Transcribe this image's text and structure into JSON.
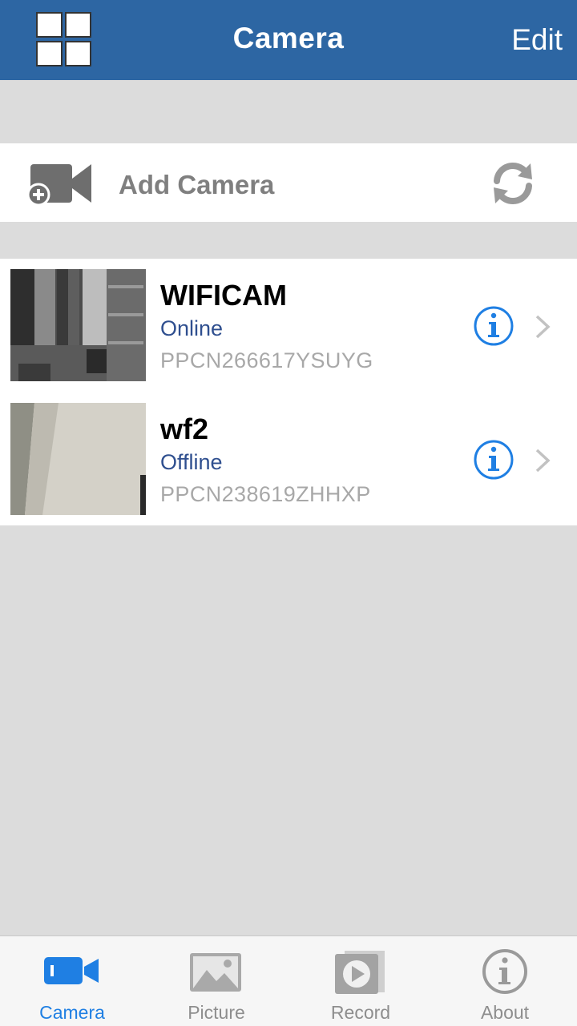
{
  "header": {
    "title": "Camera",
    "edit_label": "Edit"
  },
  "add_camera": {
    "label": "Add Camera"
  },
  "cameras": [
    {
      "name": "WIFICAM",
      "status": "Online",
      "uid": "PPCN266617YSUYG"
    },
    {
      "name": "wf2",
      "status": "Offline",
      "uid": "PPCN238619ZHHXP"
    }
  ],
  "tabs": [
    {
      "label": "Camera",
      "icon": "video-camera-icon",
      "active": true
    },
    {
      "label": "Picture",
      "icon": "picture-icon",
      "active": false
    },
    {
      "label": "Record",
      "icon": "record-play-icon",
      "active": false
    },
    {
      "label": "About",
      "icon": "info-circle-icon",
      "active": false
    }
  ],
  "colors": {
    "nav_bar": "#2d66a3",
    "status_text": "#2f4f8f",
    "info_icon": "#1f7fe3",
    "active_tab": "#1f7fe3"
  }
}
